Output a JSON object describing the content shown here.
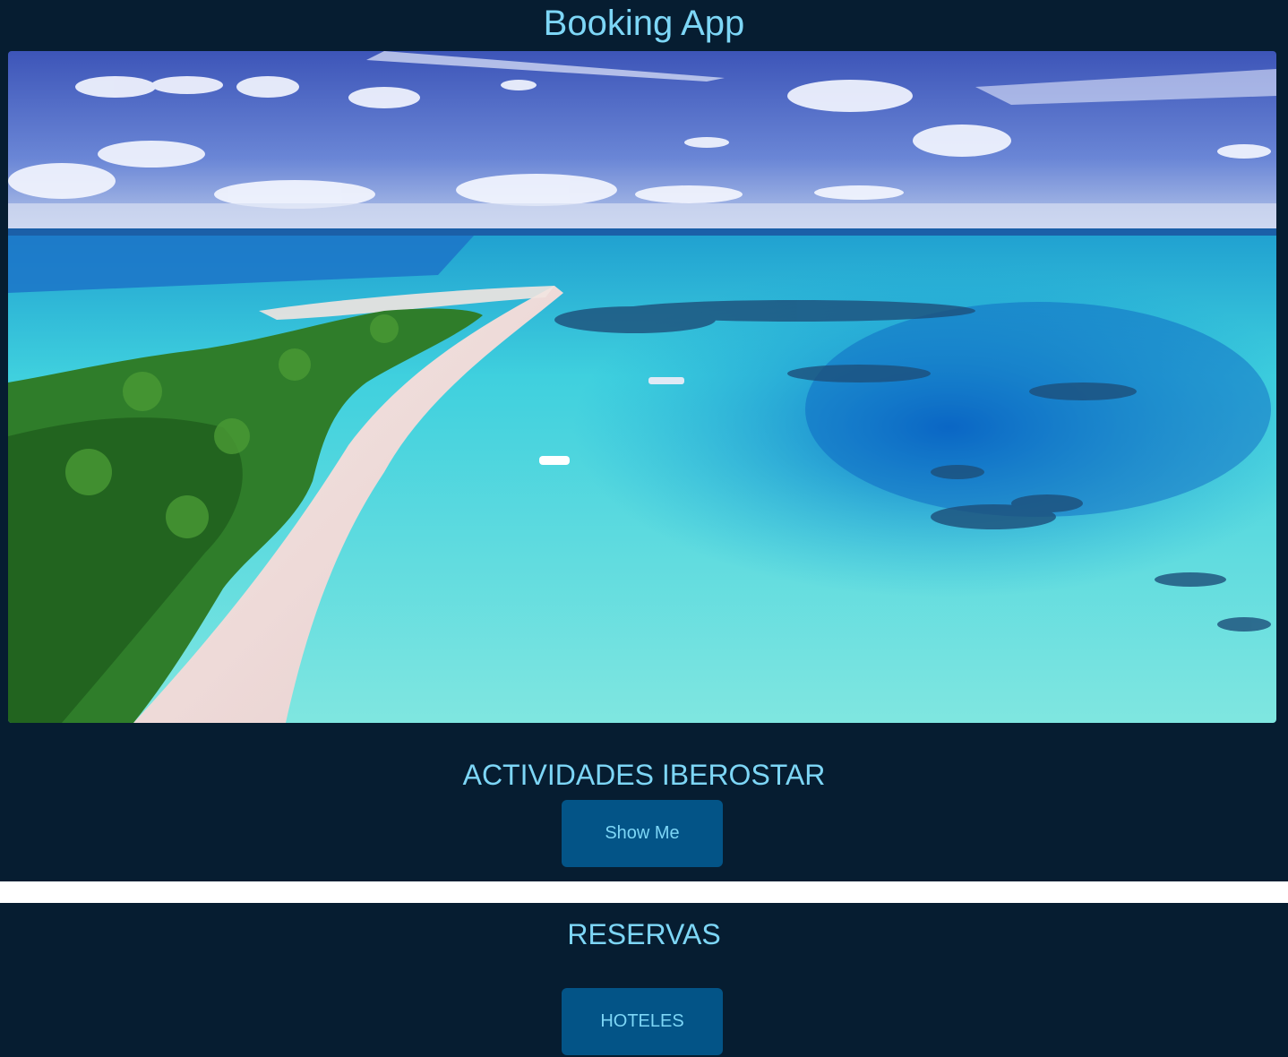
{
  "header": {
    "title": "Booking App"
  },
  "hero": {
    "description": "tropical-island-beach-photo"
  },
  "activities": {
    "heading": "ACTIVIDADES IBEROSTAR",
    "button_label": "Show Me"
  },
  "reservations": {
    "heading": "RESERVAS",
    "button_label": "HOTELES"
  },
  "colors": {
    "background": "#061d31",
    "accent_text": "#7dd6f6",
    "button_bg": "#035487",
    "divider": "#ffffff"
  }
}
